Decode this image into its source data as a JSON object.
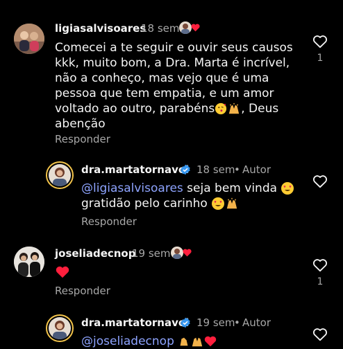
{
  "top_dot": "0",
  "comments": [
    {
      "username": "ligiasalvisoares",
      "time": "18 sem",
      "lines": [
        "Comecei a te seguir e ouvir seus causos",
        "kkk, muito bom, a Dra. Marta é incrível,",
        "não a conheço, mas vejo que é uma",
        "pessoa que tem empatia, e um amor",
        "voltado ao outro, parabéns",
        "abenção"
      ],
      "line5_tail": ", Deus",
      "reply_label": "Responder",
      "likes": "1"
    },
    {
      "username": "dra.martatornavoi",
      "time": "18 sem",
      "separator": "•",
      "author_label": "Autor",
      "mention": "@ligiasalvisoares",
      "line1_rest": " seja bem vinda",
      "line2": "gratidão pelo carinho",
      "reply_label": "Responder"
    },
    {
      "username": "joseliadecnop",
      "time": "19 sem",
      "reply_label": "Responder",
      "likes": "1"
    },
    {
      "username": "dra.martatornavoi",
      "time": "19 sem",
      "separator": "•",
      "author_label": "Autor",
      "mention": "@joseliadecnop"
    }
  ],
  "colors": {
    "background": "#000000",
    "text": "#f5f5f5",
    "muted": "#a8a8a8",
    "mention": "#8ea4ff",
    "verified": "#3797f0",
    "like_heart": "#ff3040",
    "story_ring": "#f3c44b"
  },
  "icons": [
    "heart-outline-icon",
    "verified-badge-icon",
    "red-heart-emoji",
    "kiss-emoji",
    "praying-hands-emoji",
    "smiling-hearts-emoji"
  ]
}
